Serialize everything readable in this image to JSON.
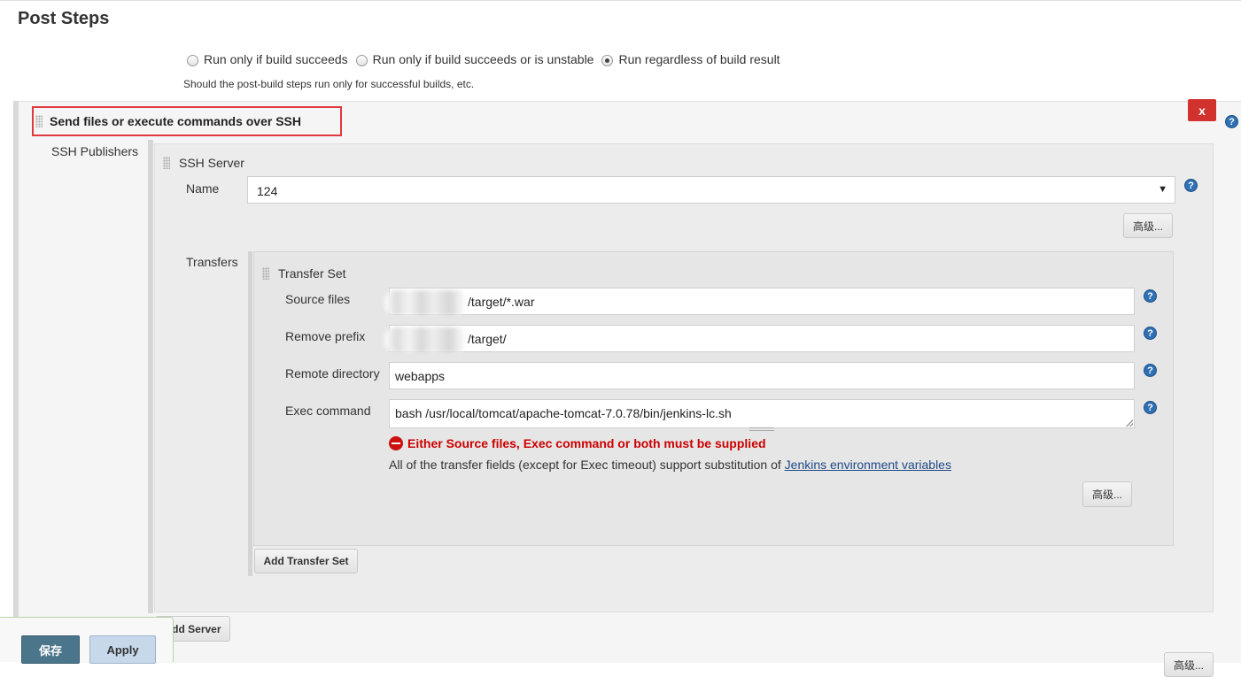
{
  "section": {
    "title": "Post Steps"
  },
  "run_condition": {
    "options": [
      {
        "label": "Run only if build succeeds",
        "checked": false
      },
      {
        "label": "Run only if build succeeds or is unstable",
        "checked": false
      },
      {
        "label": "Run regardless of build result",
        "checked": true
      }
    ],
    "hint": "Should the post-build steps run only for successful builds, etc."
  },
  "ssh_step": {
    "title": "Send files or execute commands over SSH",
    "delete_label": "x",
    "publishers_label": "SSH Publishers",
    "server": {
      "header": "SSH Server",
      "name_label": "Name",
      "name_value": "124",
      "advanced_label": "高级...",
      "transfers_label": "Transfers",
      "add_server_label": "Add Server"
    },
    "transfer_set": {
      "header": "Transfer Set",
      "source_files_label": "Source files",
      "source_files_value": "/target/*.war",
      "remove_prefix_label": "Remove prefix",
      "remove_prefix_value": "/target/",
      "remote_directory_label": "Remote directory",
      "remote_directory_value": "webapps",
      "exec_command_label": "Exec command",
      "exec_command_value": "bash /usr/local/tomcat/apache-tomcat-7.0.78/bin/jenkins-lc.sh",
      "error_text": "Either Source files, Exec command or both must be supplied",
      "info_text": "All of the transfer fields (except for Exec timeout) support substitution of ",
      "info_link": "Jenkins environment variables",
      "advanced_label": "高级...",
      "add_transfer_label": "Add Transfer Set"
    },
    "bottom_advanced_label": "高级..."
  },
  "footer": {
    "save_label": "保存",
    "apply_label": "Apply"
  },
  "icons": {
    "help": "question-circle-icon",
    "error": "no-entry-icon",
    "drag": "drag-handle-icon"
  },
  "colors": {
    "delete": "#d2322d",
    "save": "#4b758b",
    "apply": "#c7d8ea",
    "error": "#cc0000",
    "highlight": "#e0393e"
  }
}
